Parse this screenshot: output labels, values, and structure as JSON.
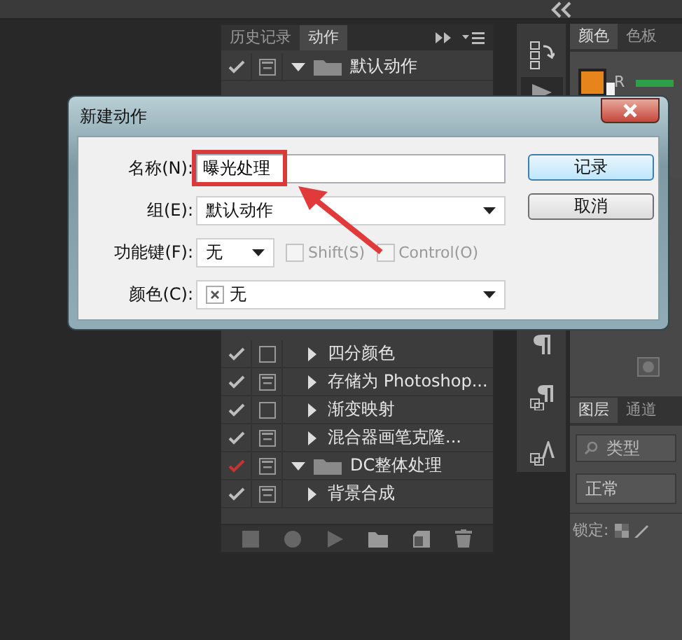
{
  "actions_panel": {
    "tabs": [
      {
        "label": "历史记录",
        "selected": false
      },
      {
        "label": "动作",
        "selected": true
      }
    ],
    "rows": [
      {
        "kind": "set",
        "label": "默认动作",
        "checked": true,
        "partial": false,
        "dialog_toggle": true,
        "expanded": true
      },
      {
        "kind": "action",
        "label": "四分颜色",
        "checked": true,
        "partial": false,
        "dialog_toggle": false,
        "expanded": false
      },
      {
        "kind": "action",
        "label": "存储为 Photoshop...",
        "checked": true,
        "partial": false,
        "dialog_toggle": true,
        "expanded": false
      },
      {
        "kind": "action",
        "label": "渐变映射",
        "checked": true,
        "partial": false,
        "dialog_toggle": false,
        "expanded": false
      },
      {
        "kind": "action",
        "label": "混合器画笔克隆...",
        "checked": true,
        "partial": false,
        "dialog_toggle": true,
        "expanded": false
      },
      {
        "kind": "set",
        "label": "DC整体处理",
        "checked": true,
        "partial": true,
        "dialog_toggle": true,
        "expanded": true
      },
      {
        "kind": "action",
        "label": "背景合成",
        "checked": true,
        "partial": false,
        "dialog_toggle": true,
        "expanded": false
      }
    ]
  },
  "color_panel": {
    "tabs": [
      {
        "label": "颜色",
        "selected": true
      },
      {
        "label": "色板",
        "selected": false
      }
    ],
    "channel": "R"
  },
  "layers_panel": {
    "tabs": [
      {
        "label": "图层",
        "selected": true
      },
      {
        "label": "通道",
        "selected": false
      }
    ],
    "filter": "类型",
    "blend_mode": "正常",
    "lock_label": "锁定:"
  },
  "dialog": {
    "title": "新建动作",
    "fields": [
      {
        "kind": "text",
        "label": "名称(N):",
        "value": "曝光处理",
        "highlighted": true
      },
      {
        "kind": "select",
        "label": "组(E):",
        "value": "默认动作"
      },
      {
        "kind": "key",
        "label": "功能键(F):",
        "value": "无",
        "checkboxes": [
          {
            "label": "Shift(S)",
            "checked": false,
            "disabled": true
          },
          {
            "label": "Control(O)",
            "checked": false,
            "disabled": true
          }
        ]
      },
      {
        "kind": "color",
        "label": "颜色(C):",
        "value": "无"
      }
    ],
    "buttons": [
      {
        "label": "记录",
        "default": true
      },
      {
        "label": "取消",
        "default": false
      }
    ]
  }
}
